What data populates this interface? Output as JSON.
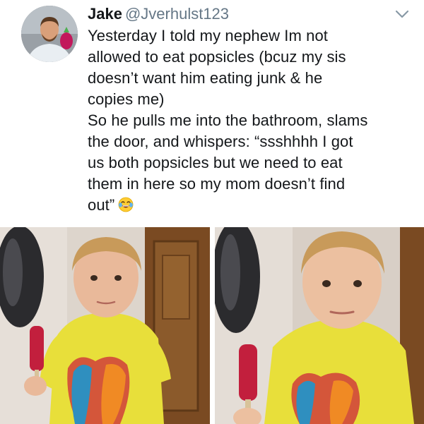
{
  "tweet": {
    "author": {
      "display_name": "Jake",
      "handle": "@Jverhulst123",
      "avatar_icon": "profile-avatar"
    },
    "menu_icon": "chevron-down-icon",
    "text_lines": [
      "Yesterday I told my nephew Im not",
      "allowed to eat popsicles (bcuz my sis",
      "doesn’t want him eating junk & he",
      "copies me)",
      "So he pulls me into the bathroom, slams",
      "the door, and whispers: “ssshhhh I got",
      "us both popsicles but we need to eat",
      "them in here so my mom doesn’t find",
      "out”"
    ],
    "emoji": "tears-of-joy-emoji",
    "media": {
      "photos": [
        "photo-boy-with-popsicle",
        "photo-boy-with-popsicle-closeup"
      ]
    }
  },
  "colors": {
    "text": "#14171a",
    "secondary_text": "#657786",
    "shirt_yellow": "#e8df3a",
    "popsicle_red": "#c21f3d",
    "door_brown": "#7a4a22"
  }
}
